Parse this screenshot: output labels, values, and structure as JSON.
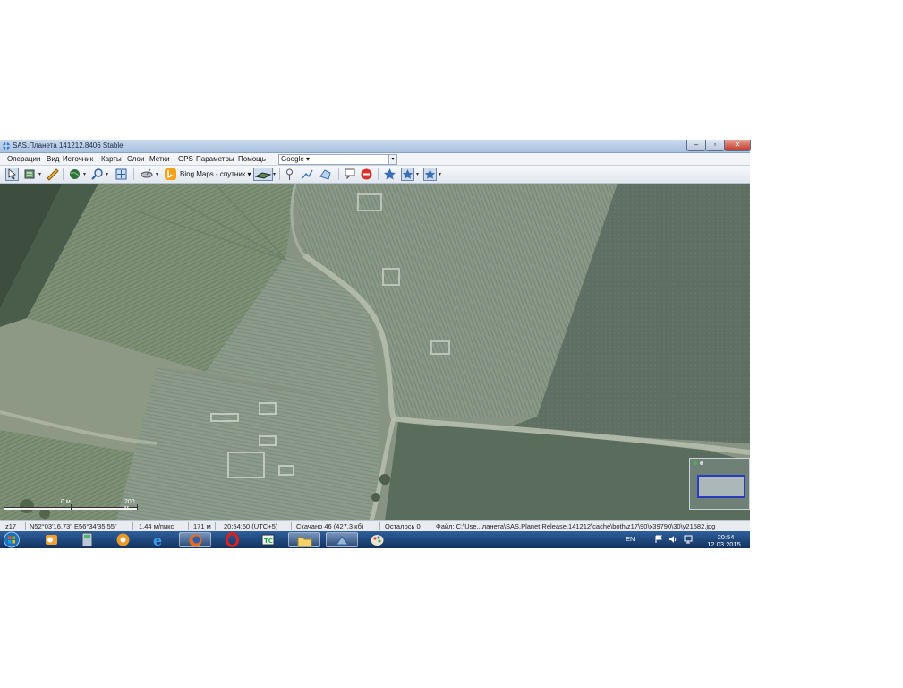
{
  "window": {
    "title": "SAS.Планета 141212.8406 Stable",
    "min_glyph": "‒",
    "max_glyph": "▫",
    "close_glyph": "✕"
  },
  "menu": [
    "Операции",
    "Вид",
    "Источник",
    "Карты",
    "Слои",
    "Метки",
    "GPS",
    "Параметры",
    "Помощь"
  ],
  "map_selector": {
    "value": "Google ▾",
    "arrow": "▾"
  },
  "toolbar": {
    "bing_label": "Bing Maps - спутник ▾",
    "icons": [
      "select-arrow-icon",
      "layers-icon",
      "ruler-icon",
      "globe-icon",
      "zoom-icon",
      "fullscreen-icon",
      "satellite-dish-icon",
      "bing-icon",
      "map-layer-icon",
      "placemark-icon",
      "path-icon",
      "polygon-icon",
      "comment-icon",
      "stop-icon",
      "star-icon",
      "star-selected-icon",
      "star-selected-icon"
    ]
  },
  "map": {
    "scale_left": "0 м",
    "scale_right": "200 м"
  },
  "status": {
    "zoom": "z17",
    "coords": "N52°03'16,73\" E56°34'35,55\"",
    "resolution": "1,44 м/пикс.",
    "elevation": "171 м",
    "time": "20:54:50 (UTC+5)",
    "downloaded": "Скачано 46 (427,3 кб)",
    "remaining": "Осталось 0",
    "file": "Файл: C:\\Use...ланета\\SAS.Planet.Release.141212\\cache\\both\\z17\\90\\x39790\\30\\y21582.jpg"
  },
  "taskbar": {
    "apps": [
      "start-orb",
      "outlook-icon",
      "calculator-icon",
      "counter-strike-icon",
      "ie-icon",
      "firefox-icon",
      "opera-icon",
      "total-commander-icon",
      "folder-icon",
      "sas-planet-icon",
      "paint-icon"
    ],
    "language": "EN",
    "time": "20:54",
    "date": "12.03.2015"
  },
  "colors": {
    "taskbar_top": "#2f5f9c",
    "taskbar_bottom": "#12325f",
    "close_red": "#c0392b",
    "minimap_frame": "#2b3bbd"
  }
}
